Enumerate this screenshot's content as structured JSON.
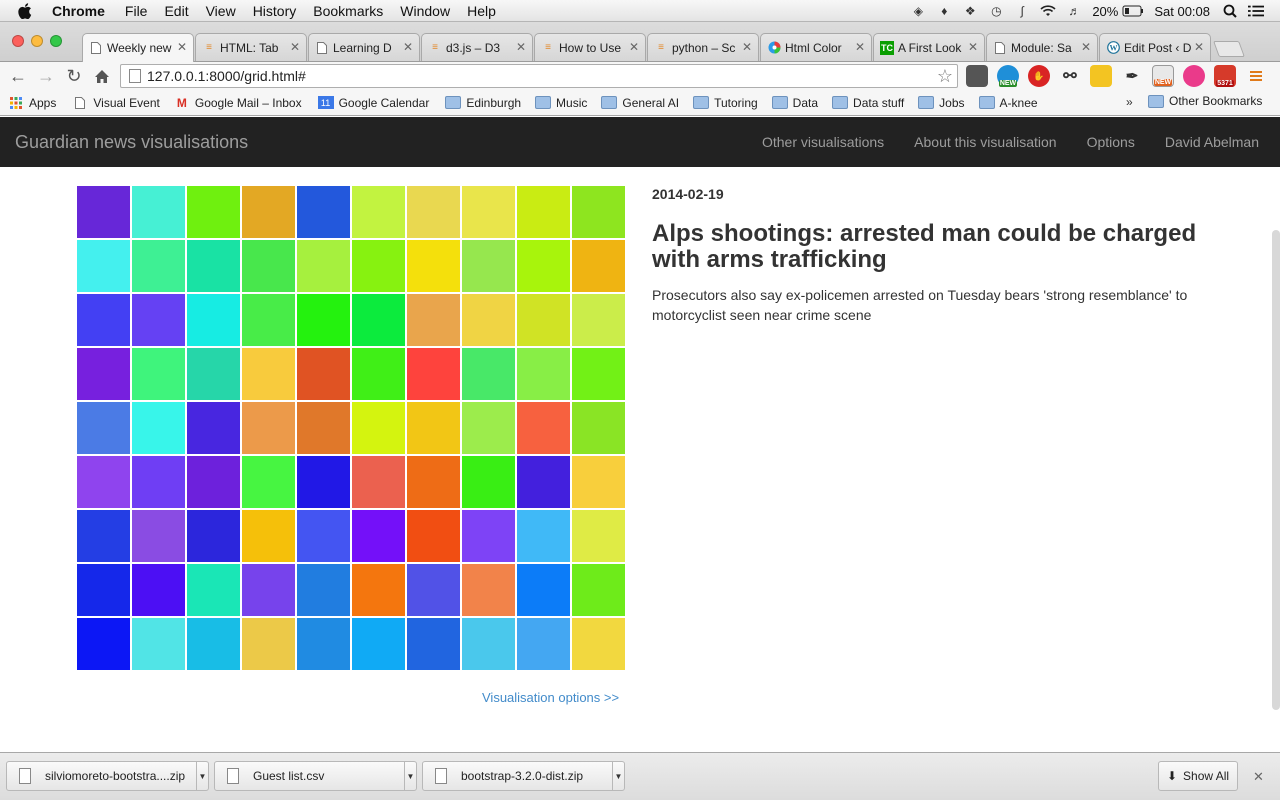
{
  "menubar": {
    "app_name": "Chrome",
    "items": [
      "File",
      "Edit",
      "View",
      "History",
      "Bookmarks",
      "Window",
      "Help"
    ],
    "battery": "20%",
    "clock": "Sat 00:08"
  },
  "tabs": [
    {
      "label": "Weekly new"
    },
    {
      "label": "HTML: Tab"
    },
    {
      "label": "Learning D"
    },
    {
      "label": "d3.js – D3"
    },
    {
      "label": "How to Use"
    },
    {
      "label": "python – Sc"
    },
    {
      "label": "Html Color"
    },
    {
      "label": "A First Look"
    },
    {
      "label": "Module: Sa"
    },
    {
      "label": "Edit Post ‹ D"
    }
  ],
  "address": {
    "url": "127.0.0.1:8000/grid.html#"
  },
  "extensions": {
    "badge_new_1": "NEW",
    "badge_new_2": "NEW",
    "mail_count": "5371"
  },
  "bookmarks": {
    "items": [
      "Apps",
      "Visual Event",
      "Google Mail – Inbox",
      "Google Calendar",
      "Edinburgh",
      "Music",
      "General AI",
      "Tutoring",
      "Data",
      "Data stuff",
      "Jobs",
      "A-knee"
    ],
    "calendar_day": "11",
    "overflow": "»",
    "other": "Other Bookmarks"
  },
  "navbar": {
    "brand": "Guardian news visualisations",
    "links": [
      "Other visualisations",
      "About this visualisation",
      "Options",
      "David Abelman"
    ]
  },
  "grid": {
    "colors": [
      [
        "#6727d8",
        "#46f0d4",
        "#6ff00f",
        "#e3a824",
        "#2358dc",
        "#c2f340",
        "#e9d850",
        "#e9e54b",
        "#c9ec13",
        "#8ee51f"
      ],
      [
        "#44f0ee",
        "#3ef094",
        "#19e2a4",
        "#48e74c",
        "#a6f03e",
        "#87f210",
        "#f4e00c",
        "#96e74e",
        "#a8f40c",
        "#efb412"
      ],
      [
        "#4340f3",
        "#6541f3",
        "#17ece3",
        "#48ec48",
        "#24f20e",
        "#0ceb3d",
        "#e9a54c",
        "#f0d444",
        "#d0e325",
        "#cbed4a"
      ],
      [
        "#7720de",
        "#3ff47c",
        "#26d6a9",
        "#f8cb3d",
        "#e05323",
        "#40ef17",
        "#fe433d",
        "#48e868",
        "#88ee46",
        "#72f116"
      ],
      [
        "#4b7be5",
        "#38f5ea",
        "#4826e0",
        "#ec9a4a",
        "#e0782a",
        "#d4f40f",
        "#f2c615",
        "#9cec4c",
        "#f7613f",
        "#8ae425"
      ],
      [
        "#8f44ee",
        "#6f3ef4",
        "#6d21dc",
        "#47f541",
        "#2118e6",
        "#eb614f",
        "#ee6c16",
        "#39ee14",
        "#4320dd",
        "#f8cf3c"
      ],
      [
        "#243ee4",
        "#8a4ce3",
        "#2c26dc",
        "#f5c00a",
        "#4455f2",
        "#7410f9",
        "#f14e12",
        "#7e43f6",
        "#40b9f7",
        "#dfeb45"
      ],
      [
        "#1528ea",
        "#4c0ff4",
        "#1ae6b6",
        "#7743ec",
        "#217de0",
        "#f4760e",
        "#5152e7",
        "#f2834a",
        "#0c7cf8",
        "#6eeb1a"
      ],
      [
        "#0c17f5",
        "#51e4e6",
        "#18bde6",
        "#ecc948",
        "#208be2",
        "#10aaf5",
        "#2165e0",
        "#4ac8ec",
        "#44a7f2",
        "#f2d83f"
      ]
    ]
  },
  "visualisation_options": "Visualisation options >>",
  "article": {
    "date": "2014-02-19",
    "headline": "Alps shootings: arrested man could be charged with arms trafficking",
    "standfirst": "Prosecutors also say ex-policemen arrested on Tuesday bears 'strong resemblance' to motorcyclist seen near crime scene"
  },
  "downloads": {
    "items": [
      "silviomoreto-bootstra....zip",
      "Guest list.csv",
      "bootstrap-3.2.0-dist.zip"
    ],
    "show_all": "Show All"
  }
}
